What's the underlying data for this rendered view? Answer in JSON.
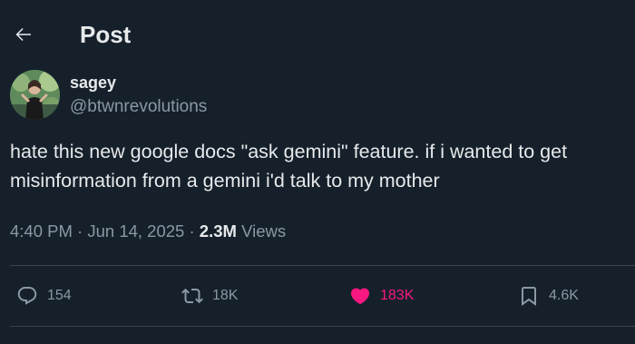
{
  "header": {
    "title": "Post",
    "back_icon": "arrow-left-icon"
  },
  "author": {
    "display_name": "sagey",
    "handle": "@btwnrevolutions"
  },
  "tweet": {
    "text": "hate this new google docs \"ask gemini\" feature. if i wanted to get\nmisinformation from a gemini i'd talk to my mother",
    "time": "4:40 PM",
    "separator": "·",
    "date": "Jun 14, 2025",
    "views_count": "2.3M",
    "views_label": "Views"
  },
  "actions": {
    "replies": {
      "icon": "reply-icon",
      "count": "154"
    },
    "reposts": {
      "icon": "retweet-icon",
      "count": "18K"
    },
    "likes": {
      "icon": "heart-icon",
      "count": "183K",
      "active": true,
      "color": "#f91880"
    },
    "bookmarks": {
      "icon": "bookmark-icon",
      "count": "4.6K"
    }
  },
  "colors": {
    "background": "#15202b",
    "primary_text": "#e7e9ea",
    "secondary_text": "#8b98a5",
    "divider": "#38444d",
    "like_pink": "#f91880"
  }
}
